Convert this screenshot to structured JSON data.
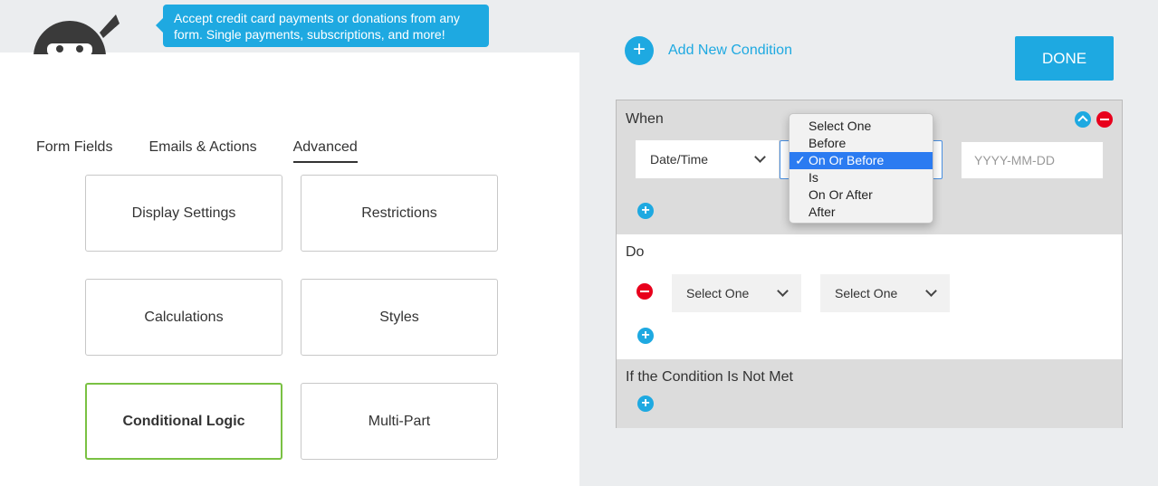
{
  "tooltip": {
    "text": "Accept credit card payments or donations from any form. Single payments, subscriptions, and more!"
  },
  "tabs": [
    {
      "label": "Form Fields"
    },
    {
      "label": "Emails & Actions"
    },
    {
      "label": "Advanced"
    }
  ],
  "tiles": {
    "display_settings": "Display Settings",
    "restrictions": "Restrictions",
    "calculations": "Calculations",
    "styles": "Styles",
    "conditional_logic": "Conditional Logic",
    "multi_part": "Multi-Part"
  },
  "add_condition": {
    "label": "Add New Condition",
    "icon": "plus-circle-icon"
  },
  "done_button": {
    "label": "DONE"
  },
  "when": {
    "label": "When",
    "field_select": "Date/Time",
    "date_placeholder": "YYYY-MM-DD"
  },
  "dropdown": {
    "options": [
      "Select One",
      "Before",
      "On Or Before",
      "Is",
      "On Or After",
      "After"
    ],
    "selected_index": 2,
    "check": "✓"
  },
  "do": {
    "label": "Do",
    "select1": "Select One",
    "select2": "Select One"
  },
  "not_met": {
    "label": "If the Condition Is Not Met"
  },
  "colors": {
    "accent": "#1ea9e1",
    "active_tile_border": "#7ac143",
    "remove": "#e8001c",
    "selected_option": "#2b7bf1"
  }
}
